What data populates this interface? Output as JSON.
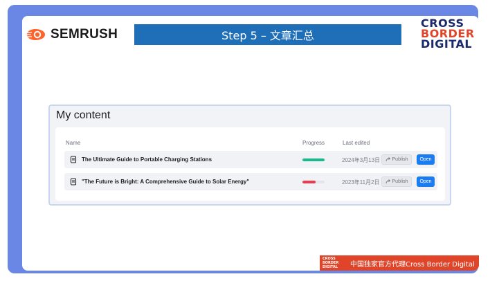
{
  "header": {
    "semrush_label": "SEMRUSH",
    "step_title": "Step 5 – 文章汇总",
    "logo_lines": [
      "CROSS",
      "BORDER",
      "DIGITAL"
    ]
  },
  "content": {
    "title": "My content",
    "columns": {
      "name": "Name",
      "progress": "Progress",
      "last_edited": "Last edited"
    },
    "rows": [
      {
        "name": "The Ultimate Guide to Portable Charging Stations",
        "progress": 1.0,
        "progress_color": "#18b98a",
        "date": "2024年3月13日",
        "publish": "Publish",
        "open": "Open"
      },
      {
        "name": "\"The Future is Bright: A Comprehensive Guide to Solar Energy\"",
        "progress": 0.6,
        "progress_color": "#ef3a4d",
        "date": "2023年11月2日",
        "publish": "Publish",
        "open": "Open"
      }
    ]
  },
  "footer": {
    "logo_lines": [
      "CROSS",
      "BORDER",
      "DIGITAL"
    ],
    "text": "中国独家官方代理Cross Border Digital"
  },
  "colors": {
    "frame": "#6b87e6",
    "banner": "#1e6fb8",
    "semrush_orange": "#ff642d",
    "accent_red": "#e0452a",
    "open_button": "#1a7cf0"
  },
  "icons": {
    "semrush": "semrush-flame-icon",
    "document": "document-icon",
    "publish": "share-arrow-icon"
  }
}
